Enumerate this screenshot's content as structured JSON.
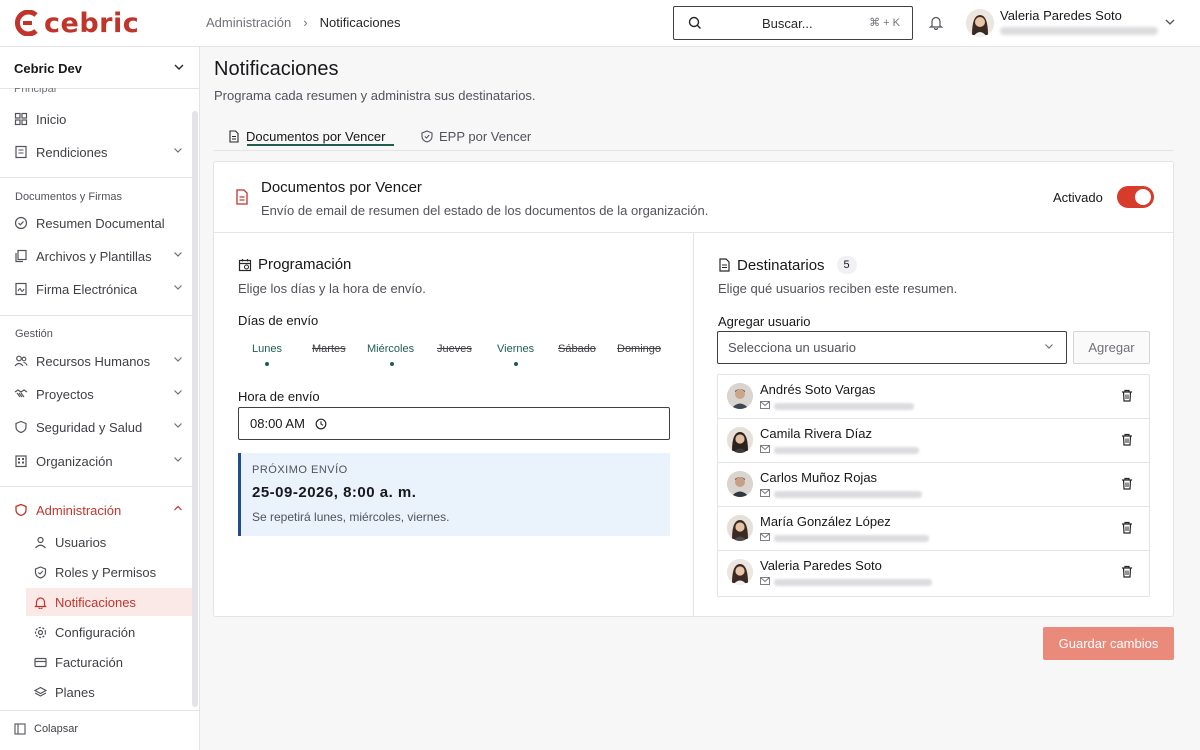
{
  "brand": {
    "name": "cebric",
    "color": "#c0352b"
  },
  "breadcrumb": {
    "parent": "Administración",
    "separator": "›",
    "current": "Notificaciones"
  },
  "search": {
    "placeholder": "Buscar...",
    "shortcut": "⌘ + K"
  },
  "user": {
    "name": "Valeria Paredes Soto"
  },
  "sidebar": {
    "org": "Cebric Dev",
    "partial_section": "Principal",
    "principal": [
      {
        "label": "Inicio",
        "icon": "grid-icon",
        "has_children": false
      },
      {
        "label": "Rendiciones",
        "icon": "receipt-icon",
        "has_children": true
      }
    ],
    "docs_title": "Documentos y Firmas",
    "docs": [
      {
        "label": "Resumen Documental",
        "icon": "check-circle-icon",
        "has_children": false
      },
      {
        "label": "Archivos y Plantillas",
        "icon": "copy-icon",
        "has_children": true
      },
      {
        "label": "Firma Electrónica",
        "icon": "signature-icon",
        "has_children": true
      }
    ],
    "gestion_title": "Gestión",
    "gestion": [
      {
        "label": "Recursos Humanos",
        "icon": "users-icon",
        "has_children": true
      },
      {
        "label": "Proyectos",
        "icon": "handshake-icon",
        "has_children": true
      },
      {
        "label": "Seguridad y Salud",
        "icon": "shield-icon",
        "has_children": true
      },
      {
        "label": "Organización",
        "icon": "building-icon",
        "has_children": true
      }
    ],
    "admin": {
      "label": "Administración",
      "icon": "shield-icon"
    },
    "admin_items": [
      {
        "label": "Usuarios",
        "icon": "user-icon",
        "active": false
      },
      {
        "label": "Roles y Permisos",
        "icon": "shield-check-icon",
        "active": false
      },
      {
        "label": "Notificaciones",
        "icon": "bell-icon",
        "active": true
      },
      {
        "label": "Configuración",
        "icon": "gear-icon",
        "active": false
      },
      {
        "label": "Facturación",
        "icon": "card-icon",
        "active": false
      },
      {
        "label": "Planes",
        "icon": "layers-icon",
        "active": false
      }
    ],
    "collapse": "Colapsar"
  },
  "page": {
    "title": "Notificaciones",
    "subtitle": "Programa cada resumen y administra sus destinatarios."
  },
  "tabs": [
    {
      "label": "Documentos por Vencer",
      "icon": "document-icon",
      "active": true
    },
    {
      "label": "EPP por Vencer",
      "icon": "shield-check-icon",
      "active": false
    }
  ],
  "card": {
    "title": "Documentos por Vencer",
    "description": "Envío de email de resumen del estado de los documentos de la organización.",
    "toggle_label": "Activado",
    "enabled": true,
    "accent": "#d63b2b"
  },
  "schedule": {
    "title": "Programación",
    "description": "Elige los días y la hora de envío.",
    "days_label": "Días de envío",
    "days": [
      {
        "label": "Lunes",
        "active": true
      },
      {
        "label": "Martes",
        "active": false
      },
      {
        "label": "Miércoles",
        "active": true
      },
      {
        "label": "Jueves",
        "active": false
      },
      {
        "label": "Viernes",
        "active": true
      },
      {
        "label": "Sábado",
        "active": false
      },
      {
        "label": "Domingo",
        "active": false
      }
    ],
    "time_label": "Hora de envío",
    "time_value": "08:00 AM",
    "next_label": "PRÓXIMO ENVÍO",
    "next_date": "25-09-2026, 8:00 a. m.",
    "repeat_note": "Se repetirá lunes, miércoles, viernes."
  },
  "recipients": {
    "title": "Destinatarios",
    "count": "5",
    "description": "Elige qué usuarios reciben este resumen.",
    "add_label": "Agregar usuario",
    "select_placeholder": "Selecciona un usuario",
    "add_button": "Agregar",
    "items": [
      {
        "name": "Andrés Soto Vargas",
        "gender": "m"
      },
      {
        "name": "Camila Rivera Díaz",
        "gender": "f"
      },
      {
        "name": "Carlos Muñoz Rojas",
        "gender": "m"
      },
      {
        "name": "María González López",
        "gender": "f"
      },
      {
        "name": "Valeria Paredes Soto",
        "gender": "f"
      }
    ]
  },
  "footer": {
    "save": "Guardar cambios"
  },
  "colors": {
    "primary_green": "#1f5e4f",
    "save_button": "#ea8a7a",
    "info_bg": "#eaf2fb"
  }
}
